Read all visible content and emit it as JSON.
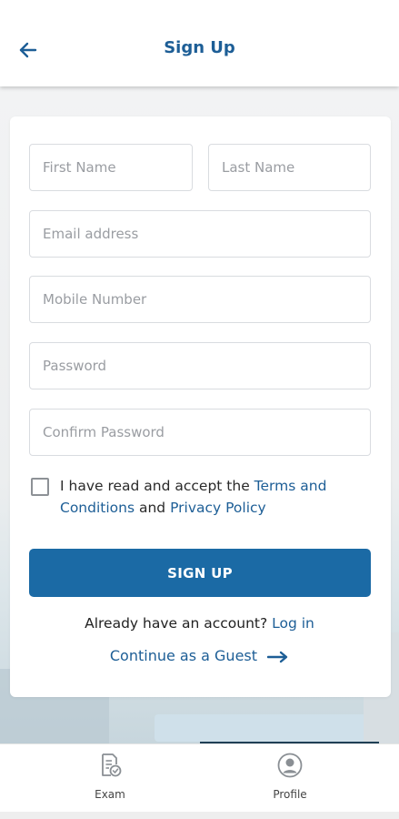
{
  "header": {
    "title": "Sign Up",
    "back_icon": "arrow-left-icon"
  },
  "form": {
    "first_name": {
      "placeholder": "First Name",
      "value": ""
    },
    "last_name": {
      "placeholder": "Last Name",
      "value": ""
    },
    "email": {
      "placeholder": "Email address",
      "value": ""
    },
    "mobile": {
      "placeholder": "Mobile Number",
      "value": ""
    },
    "password": {
      "placeholder": "Password",
      "value": ""
    },
    "confirm_password": {
      "placeholder": "Confirm Password",
      "value": ""
    }
  },
  "terms": {
    "checked": false,
    "prefix": "I have read and accept the ",
    "terms_link": "Terms and Conditions",
    "middle": " and ",
    "privacy_link": "Privacy Policy"
  },
  "signup_button": "SIGN UP",
  "login": {
    "text": "Already have an account? ",
    "link": "Log in"
  },
  "guest": {
    "text": "Continue as a Guest",
    "icon": "arrow-right-icon"
  },
  "tabs": [
    {
      "label": "Exam",
      "icon": "exam-document-icon"
    },
    {
      "label": "Profile",
      "icon": "user-profile-icon"
    }
  ],
  "colors": {
    "primary": "#1b6aa5",
    "link": "#1d5e96",
    "title": "#1d5e96"
  }
}
